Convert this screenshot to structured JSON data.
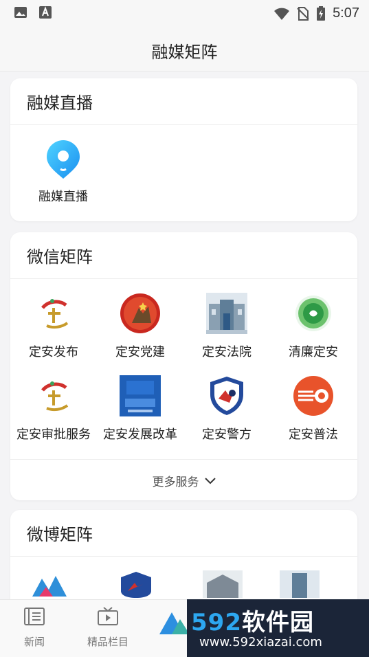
{
  "status_bar": {
    "time": "5:07"
  },
  "header": {
    "title": "融媒矩阵"
  },
  "live_section": {
    "title": "融媒直播",
    "items": [
      {
        "label": "融媒直播",
        "icon": "live-location-pin-icon"
      }
    ]
  },
  "wechat_section": {
    "title": "微信矩阵",
    "items": [
      {
        "label": "定安发布",
        "icon": "dingan-release-logo"
      },
      {
        "label": "定安党建",
        "icon": "party-building-logo"
      },
      {
        "label": "定安法院",
        "icon": "court-building-logo"
      },
      {
        "label": "清廉定安",
        "icon": "clean-government-logo"
      },
      {
        "label": "定安审批服务",
        "icon": "approval-service-logo"
      },
      {
        "label": "定安发展改革",
        "icon": "development-reform-logo"
      },
      {
        "label": "定安警方",
        "icon": "police-logo"
      },
      {
        "label": "定安普法",
        "icon": "legal-education-logo"
      }
    ],
    "more_label": "更多服务"
  },
  "weibo_section": {
    "title": "微博矩阵"
  },
  "bottom_nav": {
    "tabs": [
      {
        "label": "新闻",
        "icon": "news-icon"
      },
      {
        "label": "精品栏目",
        "icon": "video-column-icon"
      }
    ]
  },
  "watermark": {
    "brand_num": "592",
    "brand_text": "软件园",
    "url": "www.592xiazai.com"
  },
  "colors": {
    "accent_blue": "#2da7f0",
    "red": "#d0312d",
    "watermark_bg": "#1b2538"
  }
}
